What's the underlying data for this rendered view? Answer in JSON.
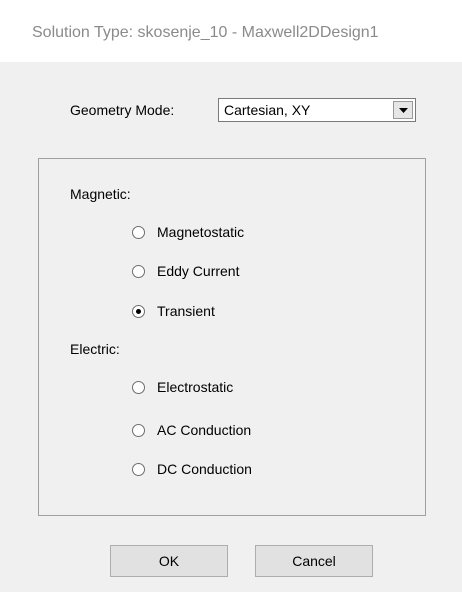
{
  "window": {
    "title": "Solution Type: skosenje_10 - Maxwell2DDesign1"
  },
  "geometry": {
    "label": "Geometry Mode:",
    "selected": "Cartesian, XY",
    "dropdown_icon": "chevron-down-icon"
  },
  "magnetic": {
    "label": "Magnetic:",
    "options": [
      {
        "label": "Magnetostatic",
        "checked": false
      },
      {
        "label": "Eddy Current",
        "checked": false
      },
      {
        "label": "Transient",
        "checked": true
      }
    ]
  },
  "electric": {
    "label": "Electric:",
    "options": [
      {
        "label": "Electrostatic",
        "checked": false
      },
      {
        "label": "AC Conduction",
        "checked": false
      },
      {
        "label": "DC Conduction",
        "checked": false
      }
    ]
  },
  "buttons": {
    "ok_label": "OK",
    "cancel_label": "Cancel"
  },
  "colors": {
    "dialog_background": "#f0f0f0",
    "title_text": "#8a8a8a"
  }
}
